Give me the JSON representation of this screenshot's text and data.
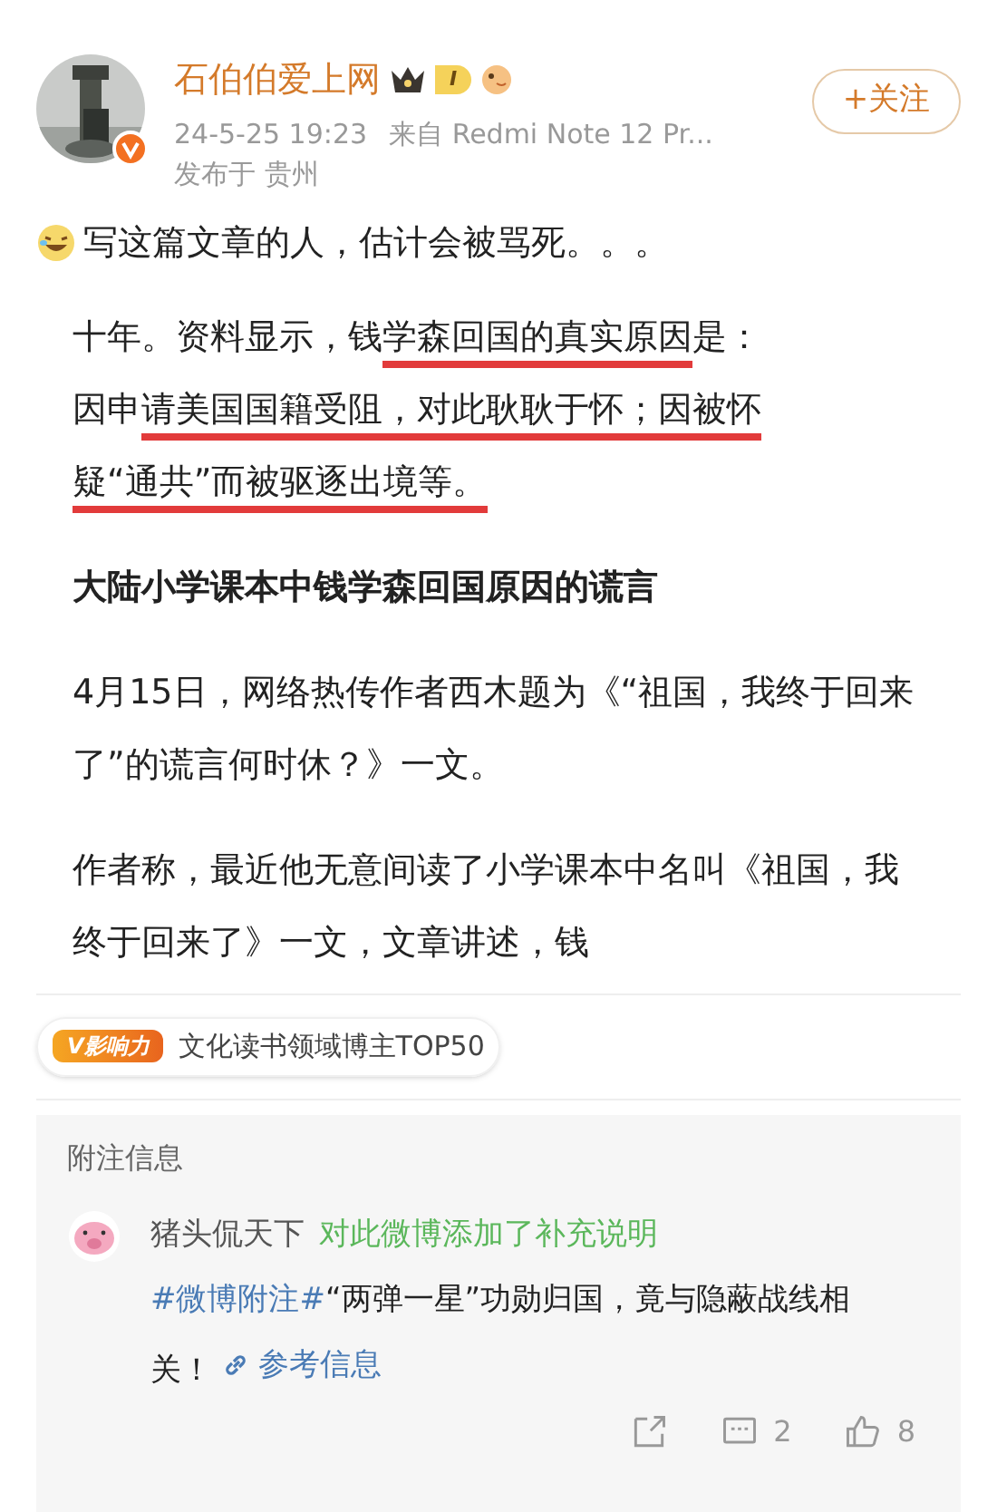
{
  "author": {
    "name": "石伯伯爱上网",
    "level": "I",
    "time": "24-5-25 19:23",
    "source": "来自 Redmi Note 12 Pr...",
    "location": "发布于 贵州",
    "verified": true
  },
  "follow_button": {
    "label": "+关注"
  },
  "intro": {
    "text": "写这篇文章的人，估计会被骂死。。。"
  },
  "quote_lines": [
    {
      "segments": [
        {
          "text": "十年。资料显示，钱",
          "underlined": false
        },
        {
          "text": "学森回国的真实原因",
          "underlined": true
        },
        {
          "text": "是：",
          "underlined": false
        }
      ]
    },
    {
      "segments": [
        {
          "text": "因申",
          "underlined": false
        },
        {
          "text": "请美国国籍受阻，对此耿耿于怀；因被怀",
          "underlined": true
        }
      ]
    },
    {
      "segments": [
        {
          "text": "疑“通共”而被驱逐出境等。",
          "underlined": true
        }
      ]
    }
  ],
  "heading": "大陆小学课本中钱学森回国原因的谎言",
  "paragraphs": [
    "4月15日，网络热传作者西木题为《“祖国，我终于回来了”的谎言何时休？》一文。",
    "作者称，最近他无意间读了小学课本中名叫《祖国，我终于回来了》一文，文章讲述，钱"
  ],
  "influence_badge": {
    "logo": "V影响力",
    "label": "文化读书领域博主TOP50"
  },
  "note": {
    "title": "附注信息",
    "author": "猪头侃天下",
    "action": "对此微博添加了补充说明",
    "hashtag": "#微博附注#",
    "text": "“两弹一星”功勋归国，竟与隐蔽战线相关！",
    "link": "参考信息"
  },
  "actions": [
    {
      "kind": "share"
    },
    {
      "kind": "comment",
      "count": "2"
    },
    {
      "kind": "like",
      "count": "8"
    }
  ]
}
